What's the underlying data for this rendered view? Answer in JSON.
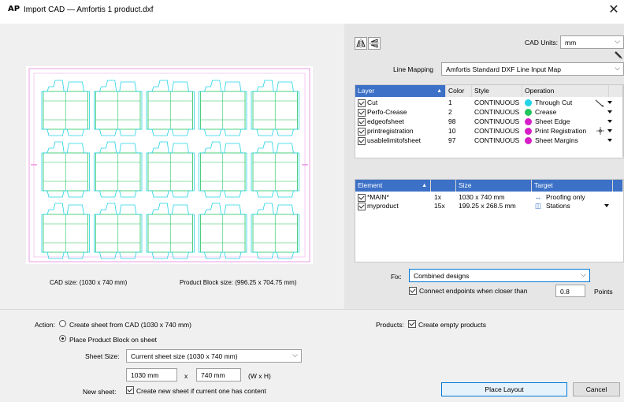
{
  "window": {
    "logo": "AP",
    "title": "Import CAD — Amfortis 1 product.dxf",
    "close_glyph": "✕"
  },
  "preview": {
    "cad_size": "CAD size: (1030 x 740 mm)",
    "block_size": "Product Block size: (996.25 x 704.75 mm)"
  },
  "units": {
    "label": "CAD Units:",
    "value": "mm"
  },
  "line_mapping": {
    "label": "Line Mapping",
    "value": "Amfortis Standard DXF Line Input Map"
  },
  "layers": {
    "headers": {
      "layer": "Layer",
      "color": "Color",
      "style": "Style",
      "operation": "Operation"
    },
    "rows": [
      {
        "name": "Cut",
        "color": "1",
        "style": "CONTINUOUS",
        "operation": "Through Cut",
        "dot": "#22d3e6"
      },
      {
        "name": "Perfo-Crease",
        "color": "2",
        "style": "CONTINUOUS",
        "operation": "Crease",
        "dot": "#22c55e"
      },
      {
        "name": "edgeofsheet",
        "color": "98",
        "style": "CONTINUOUS",
        "operation": "Sheet Edge",
        "dot": "#d61ec8"
      },
      {
        "name": "printregistration",
        "color": "10",
        "style": "CONTINUOUS",
        "operation": "Print Registration",
        "dot": "#d61ec8"
      },
      {
        "name": "usablelimitofsheet",
        "color": "97",
        "style": "CONTINUOUS",
        "operation": "Sheet Margins",
        "dot": "#d61ec8"
      }
    ]
  },
  "elements": {
    "headers": {
      "element": "Element",
      "count": "",
      "size": "Size",
      "target": "Target"
    },
    "rows": [
      {
        "name": "*MAIN*",
        "count": "1x",
        "size": "1030 x 740 mm",
        "target": "Proofing only",
        "icon": "↔"
      },
      {
        "name": "myproduct",
        "count": "15x",
        "size": "199.25 x 268.5 mm",
        "target": "Stations",
        "icon": "◫"
      }
    ]
  },
  "fix": {
    "label": "Fix:",
    "value": "Combined designs",
    "connect_label": "Connect endpoints when closer than",
    "threshold": "0.8",
    "unit": "Points"
  },
  "action": {
    "label": "Action:",
    "option_create": "Create sheet from CAD (1030 x 740 mm)",
    "option_place": "Place Product Block on sheet",
    "sheet_size_label": "Sheet Size:",
    "sheet_size_value": "Current sheet size (1030 x 740 mm)",
    "width": "1030 mm",
    "x_sep": "x",
    "height": "740 mm",
    "wh": "(W x H)",
    "new_sheet_label": "New sheet:",
    "new_sheet_option": "Create new sheet if current one has content"
  },
  "products": {
    "label": "Products:",
    "option": "Create empty products"
  },
  "buttons": {
    "place": "Place Layout",
    "cancel": "Cancel"
  },
  "colors": {
    "cut": "#22d3e6",
    "crease": "#22c55e",
    "sheet": "#d61ec8",
    "accent": "#3c71c7"
  }
}
